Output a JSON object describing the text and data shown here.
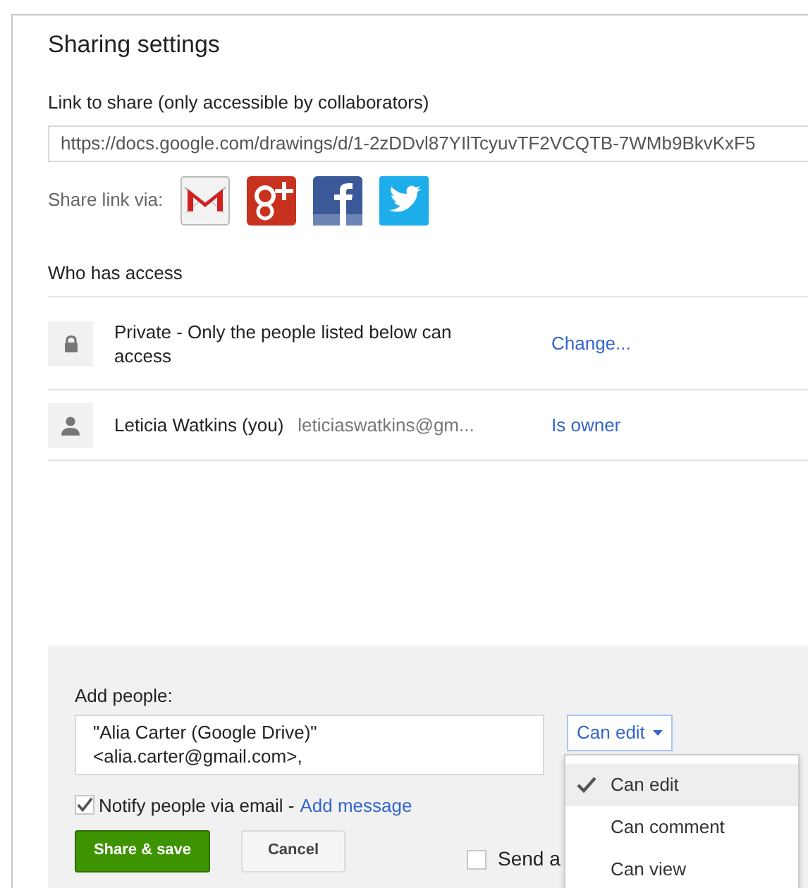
{
  "dialog": {
    "title": "Sharing settings"
  },
  "link": {
    "label": "Link to share (only accessible by collaborators)",
    "value": "https://docs.google.com/drawings/d/1-2zDDvl87YIlTcyuvTF2VCQTB-7WMb9BkvKxF5"
  },
  "share_via": {
    "label": "Share link via:",
    "services": [
      {
        "kind": "gmail"
      },
      {
        "kind": "googleplus"
      },
      {
        "kind": "facebook"
      },
      {
        "kind": "twitter"
      }
    ]
  },
  "access": {
    "heading": "Who has access",
    "entries": [
      {
        "kind": "visibility",
        "text": "Private - Only the people listed below can access",
        "action": "Change..."
      },
      {
        "kind": "person",
        "name": "Leticia Watkins (you)",
        "email": "leticiaswatkins@gm...",
        "action": "Is owner"
      }
    ]
  },
  "add_people": {
    "label": "Add people:",
    "value": "\"Alia Carter (Google Drive)\" <alia.carter@gmail.com>,",
    "permission": "Can edit",
    "menu": [
      {
        "label": "Can edit",
        "selected": true
      },
      {
        "label": "Can comment",
        "selected": false
      },
      {
        "label": "Can view",
        "selected": false
      }
    ],
    "notify": {
      "label": "Notify people via email -",
      "checked": true,
      "link": "Add message"
    },
    "buttons": [
      {
        "label": "Share & save",
        "kind": "primary"
      },
      {
        "label": "Cancel",
        "kind": "default"
      }
    ],
    "send_copy": {
      "label": "Send a",
      "checked": false
    }
  }
}
